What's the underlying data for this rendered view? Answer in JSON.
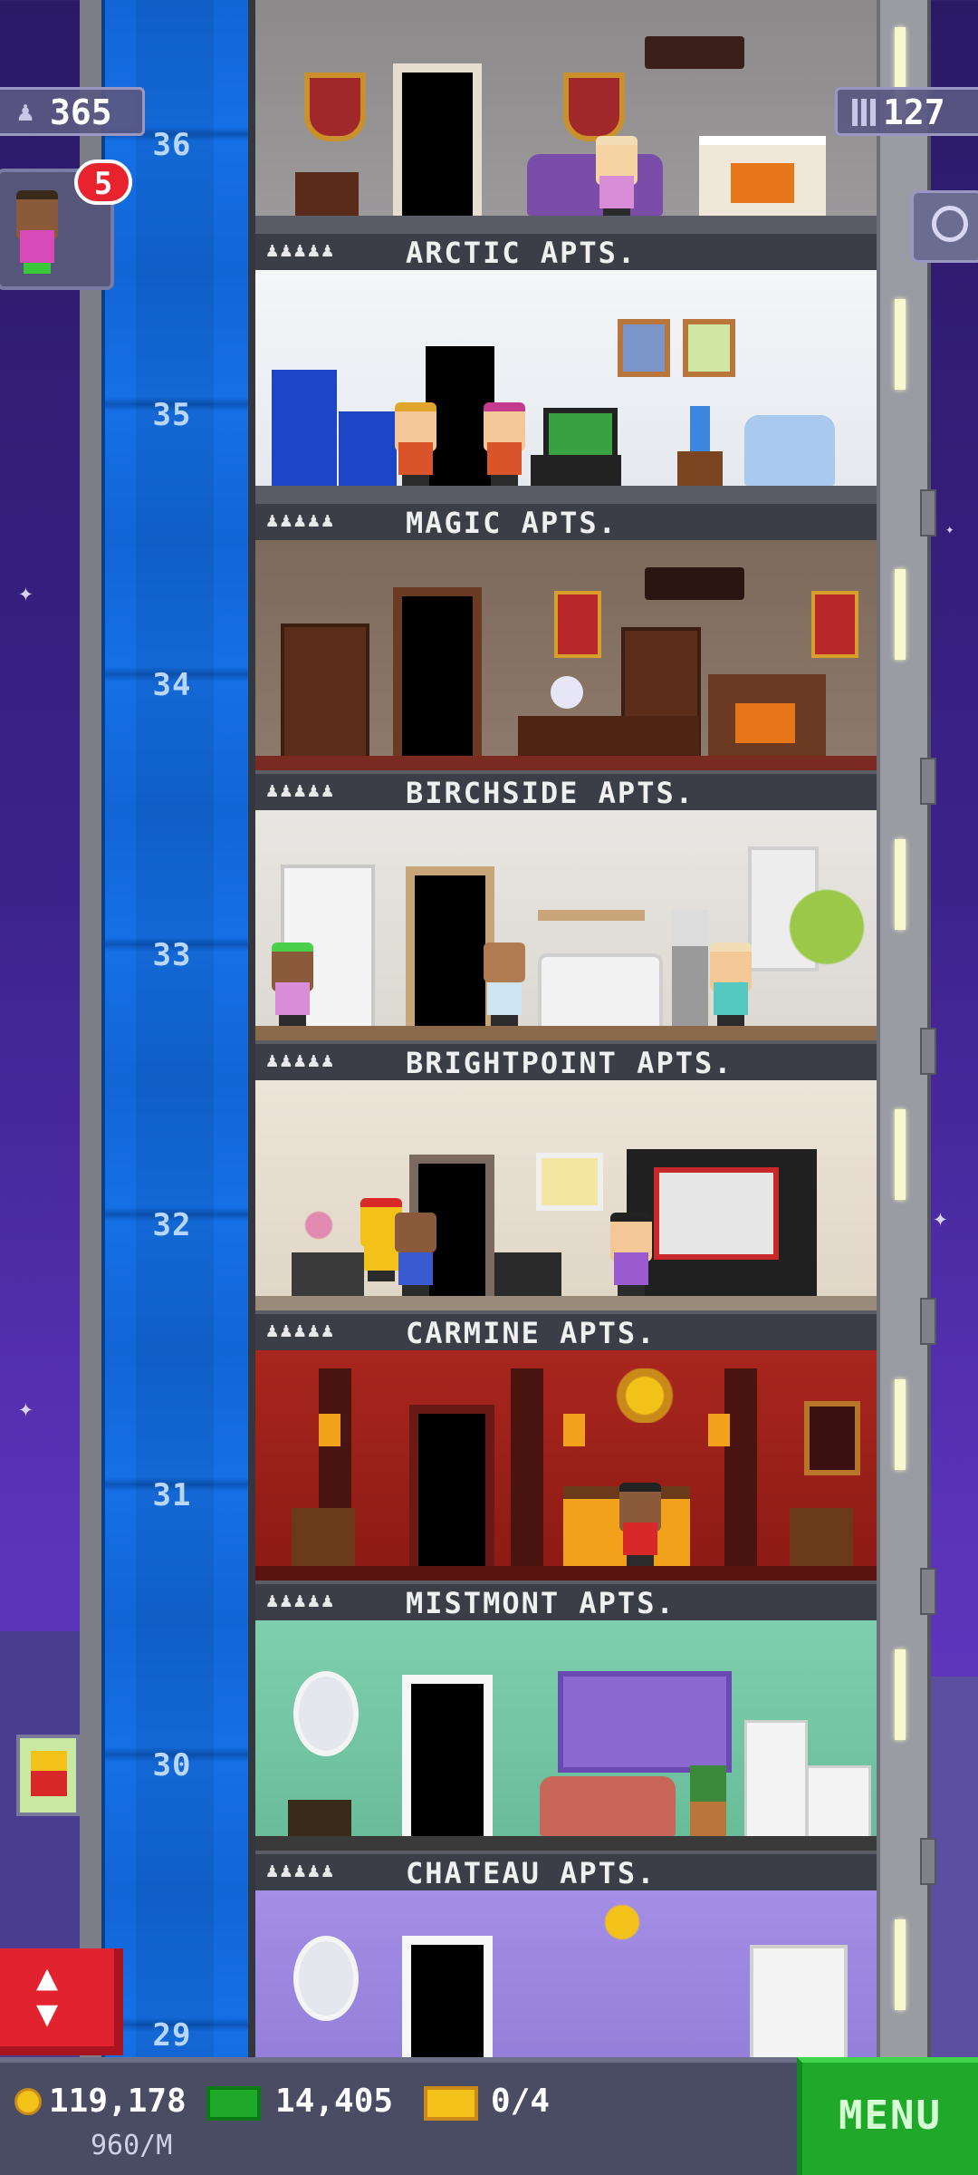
{
  "hud": {
    "population": "365",
    "floors_count": "127",
    "notification_badge": "5"
  },
  "floors": [
    {
      "number": "36",
      "name": "ARCTIC APTS."
    },
    {
      "number": "35",
      "name": "MAGIC APTS."
    },
    {
      "number": "34",
      "name": "BIRCHSIDE APTS."
    },
    {
      "number": "33",
      "name": "BRIGHTPOINT APTS."
    },
    {
      "number": "32",
      "name": "CARMINE APTS."
    },
    {
      "number": "31",
      "name": "MISTMONT APTS."
    },
    {
      "number": "30",
      "name": "CHATEAU APTS."
    },
    {
      "number": "29",
      "name": ""
    }
  ],
  "bottom_bar": {
    "coins": "119,178",
    "coin_rate": "960/M",
    "bux": "14,405",
    "tickets": "0/4",
    "menu_label": "MENU"
  },
  "icons": {
    "population": "people-icon",
    "floors": "building-icon",
    "search": "magnifier-icon",
    "elevator": "elevator-up-down-icon",
    "coins": "coin-icon",
    "bux": "bux-cash-icon",
    "tickets": "golden-ticket-icon"
  },
  "colors": {
    "sky": "#3b228a",
    "elevator_shaft": "#1570e6",
    "menu_green": "#1fa82a",
    "elevator_button_red": "#e0232e"
  }
}
